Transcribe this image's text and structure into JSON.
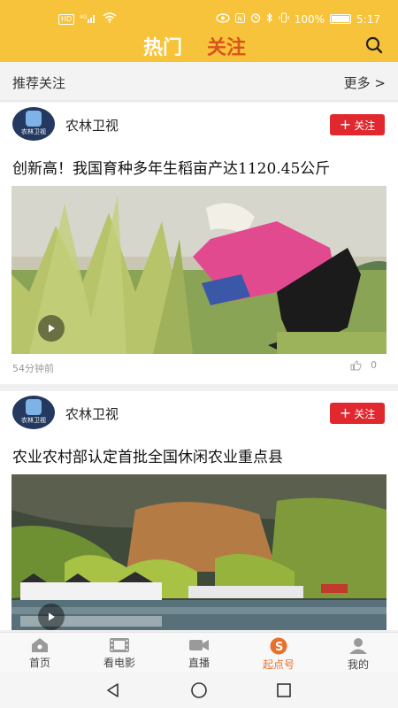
{
  "status_bar": {
    "network": "HD",
    "signal": "4G",
    "battery_percent": "100%",
    "time": "5:17"
  },
  "header": {
    "tabs": [
      {
        "label": "热门",
        "active": true
      },
      {
        "label": "关注",
        "active": false
      }
    ],
    "search_icon": "search-icon",
    "bg_color": "#f7c33a"
  },
  "recommend": {
    "title": "推荐关注",
    "more": "更多 >"
  },
  "feed": [
    {
      "channel": "农林卫视",
      "avatar_text": "农林卫视",
      "follow": "关注",
      "title": "创新高！我国育种多年生稻亩产达1120.45公斤",
      "time": "54分钟前",
      "likes": "0"
    },
    {
      "channel": "农林卫视",
      "avatar_text": "农林卫视",
      "follow": "关注",
      "title": "农业农村部认定首批全国休闲农业重点县",
      "time": "",
      "likes": ""
    }
  ],
  "bottom_nav": [
    {
      "label": "首页",
      "icon": "home-icon",
      "active": false
    },
    {
      "label": "看电影",
      "icon": "film-icon",
      "active": false
    },
    {
      "label": "直播",
      "icon": "camera-icon",
      "active": false
    },
    {
      "label": "起点号",
      "icon": "qidian-icon",
      "active": true
    },
    {
      "label": "我的",
      "icon": "person-icon",
      "active": false
    }
  ],
  "accent_color": "#e8702a",
  "follow_color": "#e0282e"
}
